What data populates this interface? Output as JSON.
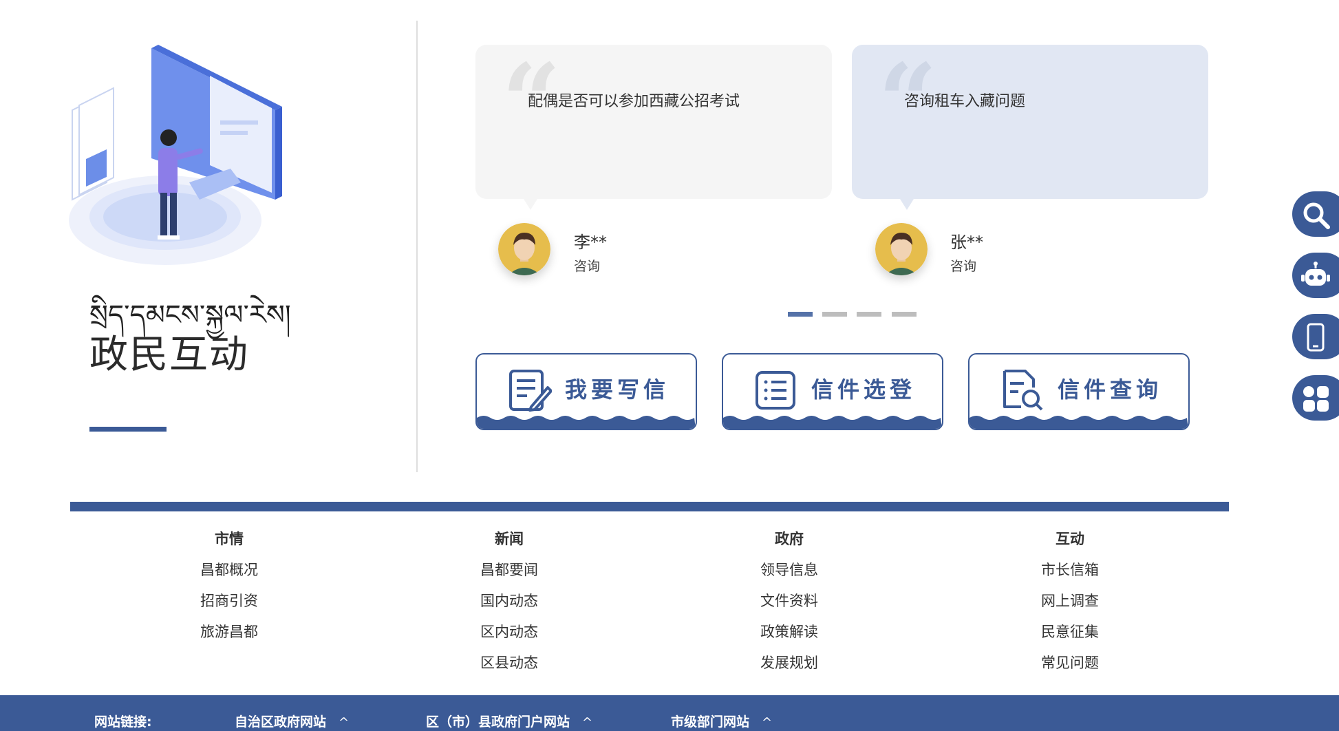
{
  "section": {
    "title_tibetan": "སྲིད་དམངས་སྐྱལ་རེས།",
    "title": "政民互动"
  },
  "letters": [
    {
      "question": "配偶是否可以参加西藏公招考试",
      "name": "李**",
      "type": "咨询"
    },
    {
      "question": "咨询租车入藏问题",
      "name": "张**",
      "type": "咨询"
    }
  ],
  "pagination": {
    "count": 4,
    "active": 1
  },
  "actions": {
    "write": "我要写信",
    "select": "信件选登",
    "query": "信件查询"
  },
  "side_tools": [
    "search-icon",
    "robot-icon",
    "mobile-icon",
    "apps-icon"
  ],
  "footer_nav": [
    {
      "title": "市情",
      "links": [
        "昌都概况",
        "招商引资",
        "旅游昌都"
      ]
    },
    {
      "title": "新闻",
      "links": [
        "昌都要闻",
        "国内动态",
        "区内动态",
        "区县动态"
      ]
    },
    {
      "title": "政府",
      "links": [
        "领导信息",
        "文件资料",
        "政策解读",
        "发展规划"
      ]
    },
    {
      "title": "互动",
      "links": [
        "市长信箱",
        "网上调查",
        "民意征集",
        "常见问题"
      ]
    }
  ],
  "site_links": {
    "label": "网站链接:",
    "items": [
      "自治区政府网站",
      "区（市）县政府门户网站",
      "市级部门网站"
    ],
    "chevron": "^"
  },
  "colors": {
    "primary": "#3b5a96",
    "card1_bg": "#f5f5f5",
    "card2_bg": "#e1e7f3",
    "dot_active": "#5572a8",
    "dot_inactive": "#bdbdbd"
  }
}
